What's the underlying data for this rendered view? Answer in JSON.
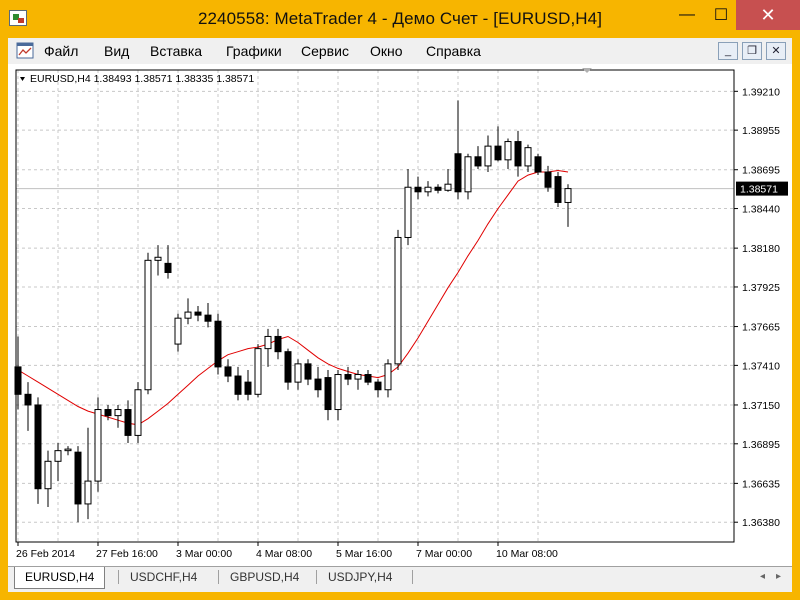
{
  "window": {
    "title": "2240558: MetaTrader 4 - Демо Счет - [EURUSD,H4]",
    "minimize_glyph": "—",
    "maximize_glyph": "☐",
    "close_glyph": "✕",
    "mdi_minimize": "_",
    "mdi_restore": "❐",
    "mdi_close": "✕"
  },
  "menu": {
    "items": [
      "Файл",
      "Вид",
      "Вставка",
      "Графики",
      "Сервис",
      "Окно",
      "Справка"
    ]
  },
  "chart_data": {
    "type": "candlestick",
    "symbol_header": "EURUSD,H4  1.38493 1.38571 1.38335 1.38571",
    "current_price_label": "1.38571",
    "current_price": 1.38571,
    "ylim": [
      1.3625,
      1.3935
    ],
    "y_ticks": [
      "1.39210",
      "1.38955",
      "1.38695",
      "1.38440",
      "1.38180",
      "1.37925",
      "1.37665",
      "1.37410",
      "1.37150",
      "1.36895",
      "1.36635",
      "1.36380"
    ],
    "x_labels": [
      "26 Feb 2014",
      "27 Feb 16:00",
      "3 Mar 00:00",
      "4 Mar 08:00",
      "5 Mar 16:00",
      "7 Mar 00:00",
      "10 Mar 08:00"
    ],
    "x_label_bars": [
      0,
      8,
      16,
      24,
      32,
      40,
      48
    ],
    "colors": {
      "bull": "#ffffff",
      "bear": "#000000",
      "ma": "#e00000",
      "grid": "#c8c8c8",
      "price_label_bg": "#000000"
    },
    "candles": [
      {
        "o": 1.374,
        "h": 1.376,
        "l": 1.3712,
        "c": 1.3722
      },
      {
        "o": 1.3722,
        "h": 1.373,
        "l": 1.3698,
        "c": 1.3715
      },
      {
        "o": 1.3715,
        "h": 1.372,
        "l": 1.365,
        "c": 1.366
      },
      {
        "o": 1.366,
        "h": 1.3685,
        "l": 1.3648,
        "c": 1.3678
      },
      {
        "o": 1.3678,
        "h": 1.369,
        "l": 1.3665,
        "c": 1.3685
      },
      {
        "o": 1.3685,
        "h": 1.3688,
        "l": 1.3682,
        "c": 1.3686
      },
      {
        "o": 1.3684,
        "h": 1.3688,
        "l": 1.3638,
        "c": 1.365
      },
      {
        "o": 1.365,
        "h": 1.37,
        "l": 1.364,
        "c": 1.3665
      },
      {
        "o": 1.3665,
        "h": 1.372,
        "l": 1.3658,
        "c": 1.3712
      },
      {
        "o": 1.3712,
        "h": 1.3715,
        "l": 1.3705,
        "c": 1.3708
      },
      {
        "o": 1.3708,
        "h": 1.3715,
        "l": 1.37,
        "c": 1.3712
      },
      {
        "o": 1.3712,
        "h": 1.3718,
        "l": 1.369,
        "c": 1.3695
      },
      {
        "o": 1.3695,
        "h": 1.373,
        "l": 1.369,
        "c": 1.3725
      },
      {
        "o": 1.3725,
        "h": 1.3815,
        "l": 1.3722,
        "c": 1.381
      },
      {
        "o": 1.381,
        "h": 1.382,
        "l": 1.38,
        "c": 1.3812
      },
      {
        "o": 1.3808,
        "h": 1.382,
        "l": 1.3798,
        "c": 1.3802
      },
      {
        "o": 1.3755,
        "h": 1.3775,
        "l": 1.375,
        "c": 1.3772
      },
      {
        "o": 1.3772,
        "h": 1.3785,
        "l": 1.3768,
        "c": 1.3776
      },
      {
        "o": 1.3776,
        "h": 1.378,
        "l": 1.377,
        "c": 1.3774
      },
      {
        "o": 1.3774,
        "h": 1.3782,
        "l": 1.3766,
        "c": 1.377
      },
      {
        "o": 1.377,
        "h": 1.3775,
        "l": 1.3735,
        "c": 1.374
      },
      {
        "o": 1.374,
        "h": 1.3745,
        "l": 1.373,
        "c": 1.3734
      },
      {
        "o": 1.3734,
        "h": 1.374,
        "l": 1.3718,
        "c": 1.3722
      },
      {
        "o": 1.373,
        "h": 1.3738,
        "l": 1.3718,
        "c": 1.3722
      },
      {
        "o": 1.3722,
        "h": 1.3755,
        "l": 1.372,
        "c": 1.3752
      },
      {
        "o": 1.3752,
        "h": 1.3765,
        "l": 1.374,
        "c": 1.376
      },
      {
        "o": 1.376,
        "h": 1.3765,
        "l": 1.3745,
        "c": 1.375
      },
      {
        "o": 1.375,
        "h": 1.3752,
        "l": 1.3725,
        "c": 1.373
      },
      {
        "o": 1.373,
        "h": 1.3745,
        "l": 1.3725,
        "c": 1.3742
      },
      {
        "o": 1.3742,
        "h": 1.3745,
        "l": 1.3728,
        "c": 1.3732
      },
      {
        "o": 1.3732,
        "h": 1.374,
        "l": 1.372,
        "c": 1.3725
      },
      {
        "o": 1.3733,
        "h": 1.3738,
        "l": 1.3705,
        "c": 1.3712
      },
      {
        "o": 1.3712,
        "h": 1.3738,
        "l": 1.3705,
        "c": 1.3735
      },
      {
        "o": 1.3735,
        "h": 1.374,
        "l": 1.3728,
        "c": 1.3732
      },
      {
        "o": 1.3732,
        "h": 1.3738,
        "l": 1.3725,
        "c": 1.3735
      },
      {
        "o": 1.3735,
        "h": 1.3738,
        "l": 1.3728,
        "c": 1.373
      },
      {
        "o": 1.373,
        "h": 1.3732,
        "l": 1.372,
        "c": 1.3725
      },
      {
        "o": 1.3725,
        "h": 1.3745,
        "l": 1.372,
        "c": 1.3742
      },
      {
        "o": 1.3742,
        "h": 1.383,
        "l": 1.3738,
        "c": 1.3825
      },
      {
        "o": 1.3825,
        "h": 1.387,
        "l": 1.382,
        "c": 1.3858
      },
      {
        "o": 1.3858,
        "h": 1.3865,
        "l": 1.385,
        "c": 1.3855
      },
      {
        "o": 1.3855,
        "h": 1.3862,
        "l": 1.3852,
        "c": 1.3858
      },
      {
        "o": 1.3858,
        "h": 1.386,
        "l": 1.3854,
        "c": 1.3856
      },
      {
        "o": 1.3856,
        "h": 1.387,
        "l": 1.3855,
        "c": 1.386
      },
      {
        "o": 1.388,
        "h": 1.3915,
        "l": 1.385,
        "c": 1.3855
      },
      {
        "o": 1.3855,
        "h": 1.388,
        "l": 1.385,
        "c": 1.3878
      },
      {
        "o": 1.3878,
        "h": 1.3885,
        "l": 1.387,
        "c": 1.3872
      },
      {
        "o": 1.3872,
        "h": 1.3892,
        "l": 1.3868,
        "c": 1.3885
      },
      {
        "o": 1.3885,
        "h": 1.3898,
        "l": 1.3875,
        "c": 1.3876
      },
      {
        "o": 1.3876,
        "h": 1.389,
        "l": 1.387,
        "c": 1.3888
      },
      {
        "o": 1.3888,
        "h": 1.3895,
        "l": 1.3865,
        "c": 1.3872
      },
      {
        "o": 1.3872,
        "h": 1.3886,
        "l": 1.3868,
        "c": 1.3884
      },
      {
        "o": 1.3878,
        "h": 1.388,
        "l": 1.3866,
        "c": 1.3868
      },
      {
        "o": 1.3868,
        "h": 1.3872,
        "l": 1.3855,
        "c": 1.3858
      },
      {
        "o": 1.3865,
        "h": 1.3868,
        "l": 1.3845,
        "c": 1.3848
      },
      {
        "o": 1.3848,
        "h": 1.386,
        "l": 1.3832,
        "c": 1.38571
      }
    ],
    "ma": [
      1.3738,
      1.3734,
      1.373,
      1.3726,
      1.3722,
      1.3718,
      1.3714,
      1.3711,
      1.3709,
      1.3707,
      1.3705,
      1.3703,
      1.3702,
      1.3706,
      1.3711,
      1.3716,
      1.3722,
      1.3728,
      1.3734,
      1.3739,
      1.3744,
      1.3748,
      1.375,
      1.3752,
      1.3753,
      1.3755,
      1.3758,
      1.376,
      1.3756,
      1.3751,
      1.3746,
      1.3742,
      1.3739,
      1.3737,
      1.3735,
      1.3734,
      1.3733,
      1.3735,
      1.374,
      1.3749,
      1.3759,
      1.377,
      1.3781,
      1.3792,
      1.3802,
      1.3813,
      1.3823,
      1.3834,
      1.3844,
      1.3853,
      1.3862,
      1.3866,
      1.3868,
      1.3868,
      1.3869,
      1.3868
    ]
  },
  "tabs": [
    "EURUSD,H4",
    "USDCHF,H4",
    "GBPUSD,H4",
    "USDJPY,H4"
  ],
  "tab_scroll": {
    "left": "◂",
    "right": "▸"
  }
}
